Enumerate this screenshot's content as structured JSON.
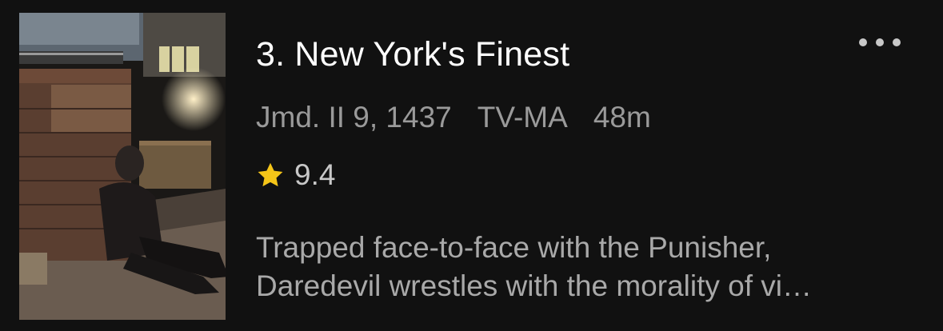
{
  "episode": {
    "title": "3. New York's Finest",
    "meta": {
      "date": "Jmd. II 9, 1437",
      "rating_label": "TV-MA",
      "duration": "48m"
    },
    "score": "9.4",
    "description_lines": [
      "Trapped face-to-face with the Punisher,",
      "Daredevil wrestles with the morality of vi…"
    ],
    "thumbnail": "episode-still-rooftop",
    "icons": {
      "more": "more-horizontal-icon",
      "star": "star-icon"
    },
    "colors": {
      "background": "#111111",
      "title": "#ffffff",
      "meta": "#9a9a9a",
      "star": "#f5c518"
    }
  }
}
